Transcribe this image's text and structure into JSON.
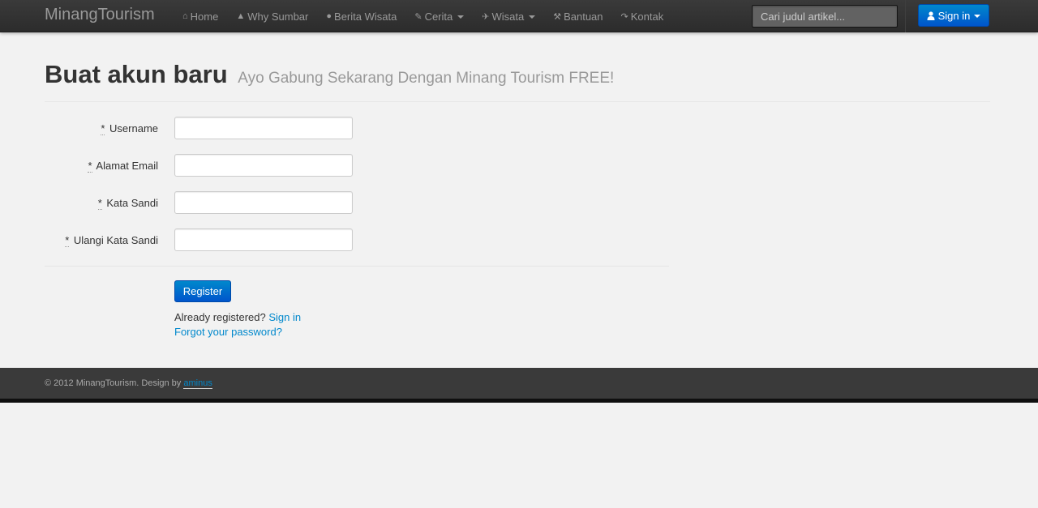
{
  "navbar": {
    "brand": "MinangTourism",
    "items": [
      {
        "label": "Home",
        "icon": "home-icon",
        "glyph": "⌂",
        "dropdown": false
      },
      {
        "label": "Why Sumbar",
        "icon": "road-icon",
        "glyph": "▲",
        "dropdown": false
      },
      {
        "label": "Berita Wisata",
        "icon": "globe-icon",
        "glyph": "●",
        "dropdown": false
      },
      {
        "label": "Cerita",
        "icon": "pencil-icon",
        "glyph": "✎",
        "dropdown": true
      },
      {
        "label": "Wisata",
        "icon": "plane-icon",
        "glyph": "✈",
        "dropdown": true
      },
      {
        "label": "Bantuan",
        "icon": "wrench-icon",
        "glyph": "⚒",
        "dropdown": false
      },
      {
        "label": "Kontak",
        "icon": "share-icon",
        "glyph": "↷",
        "dropdown": false
      }
    ],
    "search_placeholder": "Cari judul artikel...",
    "signin_label": "Sign in",
    "signin_icon": "user-icon"
  },
  "header": {
    "title": "Buat akun baru",
    "subtitle": "Ayo Gabung Sekarang Dengan Minang Tourism FREE!"
  },
  "form": {
    "required_mark": "*",
    "fields": [
      {
        "label": "Username",
        "value": ""
      },
      {
        "label": "Alamat Email",
        "value": ""
      },
      {
        "label": "Kata Sandi",
        "value": ""
      },
      {
        "label": "Ulangi Kata Sandi",
        "value": ""
      }
    ],
    "register_label": "Register",
    "already_text": "Already registered?",
    "signin_link": "Sign in",
    "forgot_link": "Forgot your password?"
  },
  "footer": {
    "copyright": "© 2012 MinangTourism. Design by",
    "author": "aminus"
  },
  "colors": {
    "accent": "#0088cc",
    "navbar": "#2c2c2c",
    "footer": "#3a3a3a"
  }
}
